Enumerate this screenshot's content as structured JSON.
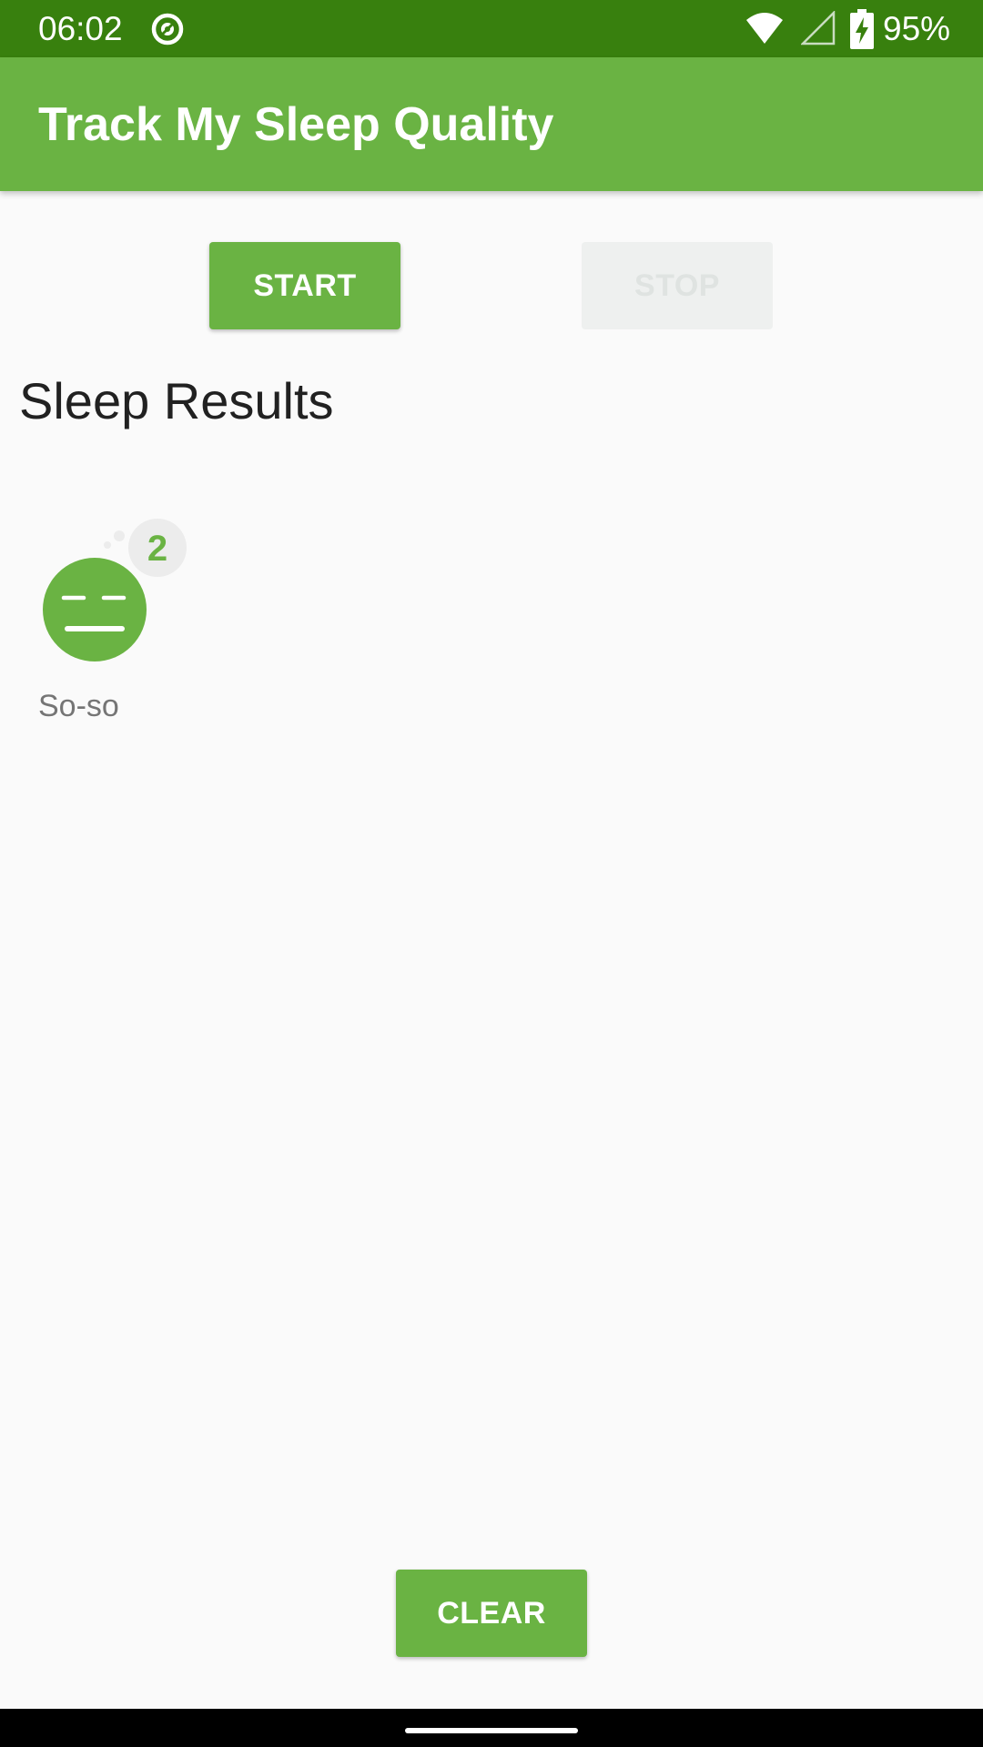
{
  "status_bar": {
    "time": "06:02",
    "battery_percent": "95%",
    "background_color": "#38800e"
  },
  "app_bar": {
    "title": "Track My Sleep Quality",
    "background_color": "#6ab343"
  },
  "buttons": {
    "start_label": "START",
    "stop_label": "STOP",
    "clear_label": "CLEAR"
  },
  "sleep_results": {
    "title": "Sleep Results",
    "items": [
      {
        "quality_label": "So-so",
        "quality_score": "2",
        "icon": "so-so-face-icon"
      }
    ]
  }
}
